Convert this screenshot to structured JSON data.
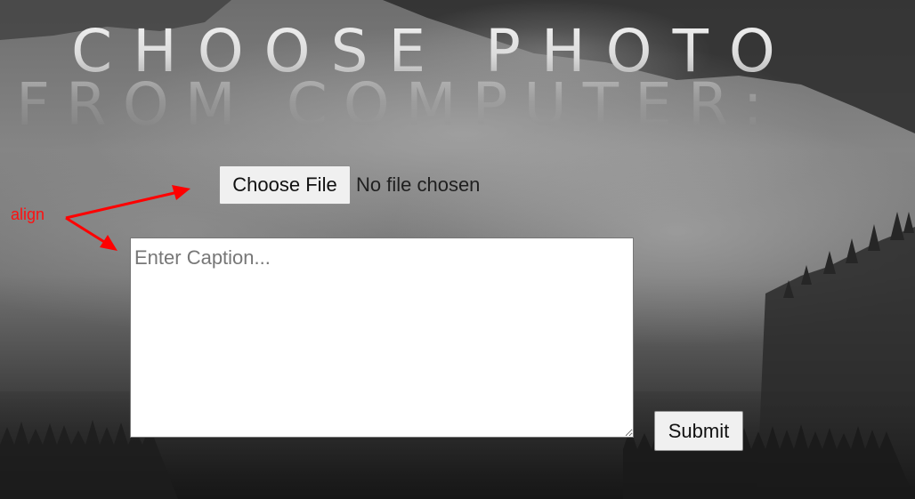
{
  "page": {
    "title_line1": "CHOOSE PHOTO",
    "title_line2": "FROM COMPUTER:"
  },
  "upload": {
    "choose_file_label": "Choose File",
    "file_status": "No file chosen"
  },
  "caption": {
    "value": "",
    "placeholder": "Enter Caption..."
  },
  "submit": {
    "label": "Submit"
  },
  "annotation": {
    "label": "align",
    "color": "#ff0000"
  },
  "colors": {
    "background_dark": "#1e1e1e",
    "background_light": "#8a8a8a"
  }
}
